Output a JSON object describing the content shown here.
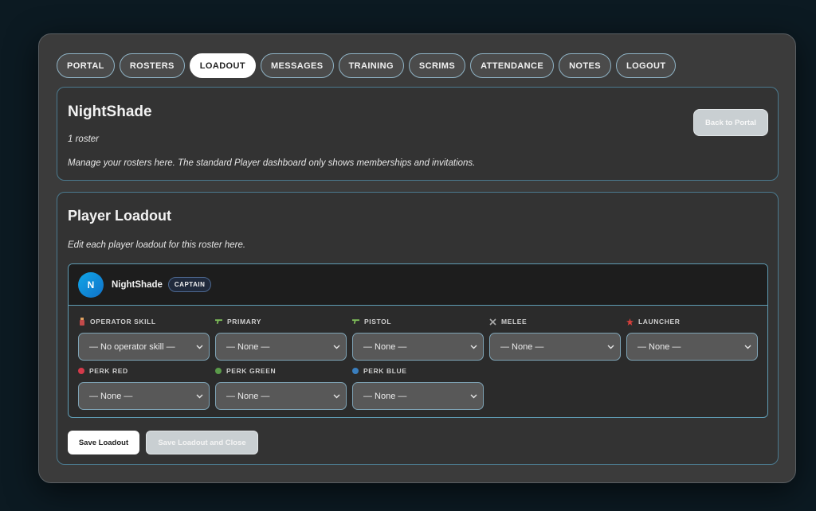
{
  "nav": {
    "tabs": [
      {
        "label": "PORTAL"
      },
      {
        "label": "ROSTERS"
      },
      {
        "label": "LOADOUT",
        "active": true
      },
      {
        "label": "MESSAGES"
      },
      {
        "label": "TRAINING"
      },
      {
        "label": "SCRIMS"
      },
      {
        "label": "ATTENDANCE"
      },
      {
        "label": "NOTES"
      },
      {
        "label": "LOGOUT"
      }
    ]
  },
  "team": {
    "name": "NightShade",
    "roster_count": "1 roster",
    "description": "Manage your rosters here. The standard Player dashboard only shows memberships and invitations.",
    "back_label": "Back to Portal"
  },
  "loadout": {
    "title": "Player Loadout",
    "description": "Edit each player loadout for this roster here.",
    "player": {
      "avatar_initial": "N",
      "name": "NightShade",
      "badge": "CAPTAIN"
    },
    "slots": [
      {
        "label": "OPERATOR SKILL",
        "value": "— No operator skill —",
        "icon": "operator-skill-icon"
      },
      {
        "label": "PRIMARY",
        "value": "— None —",
        "icon": "primary-weapon-icon"
      },
      {
        "label": "PISTOL",
        "value": "— None —",
        "icon": "pistol-icon"
      },
      {
        "label": "MELEE",
        "value": "— None —",
        "icon": "melee-icon"
      },
      {
        "label": "LAUNCHER",
        "value": "— None —",
        "icon": "launcher-icon"
      },
      {
        "label": "PERK RED",
        "value": "— None —",
        "icon": "perk-red-dot-icon",
        "color": "#d43a4a"
      },
      {
        "label": "PERK GREEN",
        "value": "— None —",
        "icon": "perk-green-dot-icon",
        "color": "#5a9a4a"
      },
      {
        "label": "PERK BLUE",
        "value": "— None —",
        "icon": "perk-blue-dot-icon",
        "color": "#3a7fbf"
      }
    ],
    "save_label": "Save Loadout",
    "save_close_label": "Save Loadout and Close"
  },
  "colors": {
    "background": "#0c1a22",
    "panel": "#3b3b3b",
    "accent_border": "#5f9cb4",
    "avatar": "#0fa6e8"
  }
}
